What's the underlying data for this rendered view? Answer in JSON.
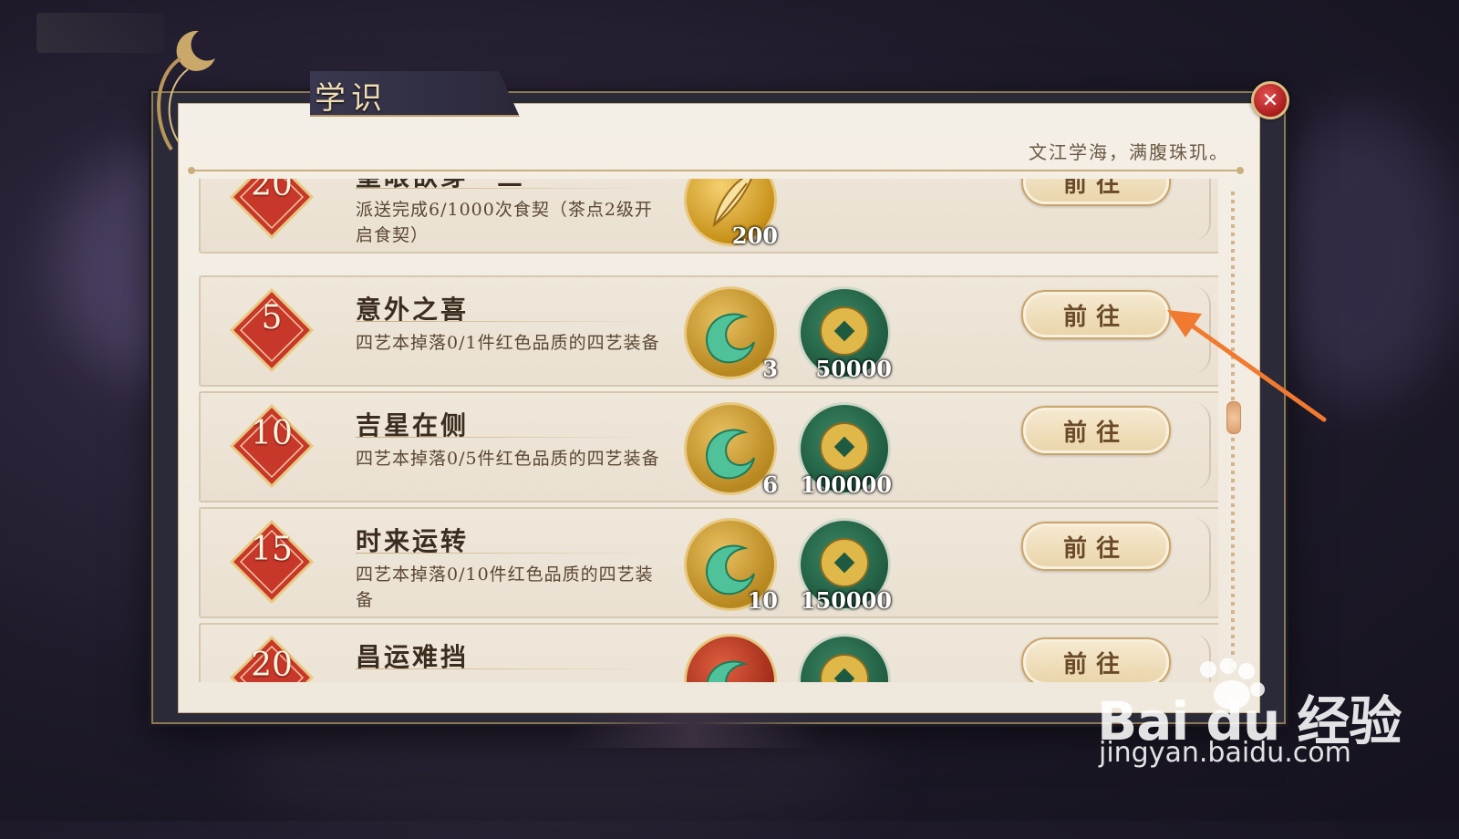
{
  "window": {
    "title": "学识",
    "subtitle": "文江学海，满腹珠玑。"
  },
  "colors": {
    "accent_gold": "#caa46a",
    "badge_red": "#c8382a",
    "close_red": "#c8282a",
    "arrow_orange": "#f07a30",
    "panel_bg": "#f4efe6"
  },
  "icons": {
    "close": "close-icon",
    "feather": "feather-icon",
    "jade": "jade-pendant-icon",
    "coin": "copper-coin-icon",
    "badge": "diamond-badge-icon"
  },
  "achievements": [
    {
      "level": "20",
      "title": "望眼欲穿・三",
      "description": "派送完成6/1000次食契（茶点2级开启食契）",
      "rewards": [
        {
          "type": "feather",
          "count": "200"
        }
      ],
      "button": "前往"
    },
    {
      "level": "5",
      "title": "意外之喜",
      "description": "四艺本掉落0/1件红色品质的四艺装备",
      "rewards": [
        {
          "type": "jade",
          "count": "3"
        },
        {
          "type": "coin",
          "count": "50000"
        }
      ],
      "button": "前往"
    },
    {
      "level": "10",
      "title": "吉星在侧",
      "description": "四艺本掉落0/5件红色品质的四艺装备",
      "rewards": [
        {
          "type": "jade",
          "count": "6"
        },
        {
          "type": "coin",
          "count": "100000"
        }
      ],
      "button": "前往"
    },
    {
      "level": "15",
      "title": "时来运转",
      "description": "四艺本掉落0/10件红色品质的四艺装备",
      "rewards": [
        {
          "type": "jade",
          "count": "10"
        },
        {
          "type": "coin",
          "count": "150000"
        }
      ],
      "button": "前往"
    },
    {
      "level": "20",
      "title": "昌运难挡",
      "description": "",
      "rewards": [
        {
          "type": "jade",
          "count": ""
        },
        {
          "type": "coin",
          "count": ""
        }
      ],
      "button": "前往"
    }
  ],
  "watermark": {
    "brand": "Bai du 经验",
    "url": "jingyan.baidu.com"
  }
}
